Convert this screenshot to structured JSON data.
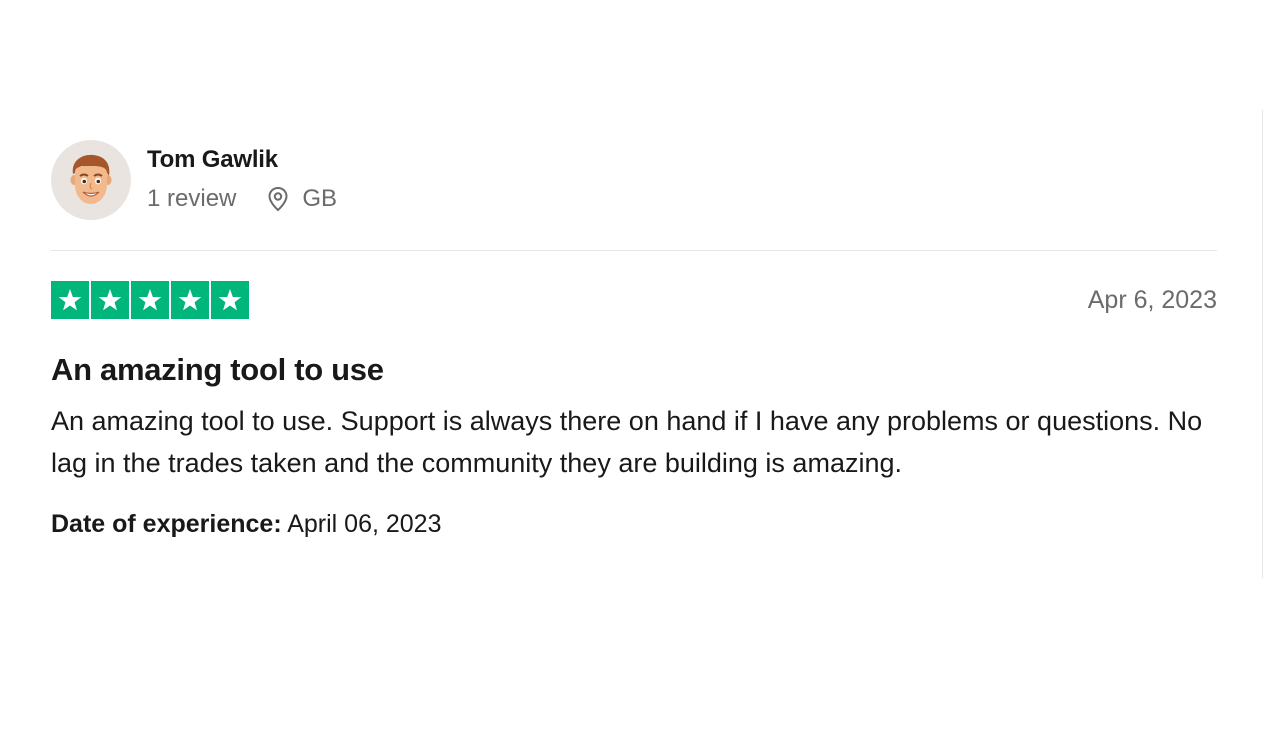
{
  "reviewer": {
    "name": "Tom Gawlik",
    "review_count": "1 review",
    "country": "GB",
    "avatar_icon": "memoji-avatar",
    "location_icon": "location-pin-icon"
  },
  "review": {
    "rating": 5,
    "rating_max": 5,
    "star_color": "#00b67a",
    "date": "Apr 6, 2023",
    "title": "An amazing tool to use",
    "body": "An amazing tool to use. Support is always there on hand if I have any problems or questions. No lag in the trades taken and the community they are building is amazing.",
    "experience_label": "Date of experience:",
    "experience_date": "April 06, 2023"
  }
}
